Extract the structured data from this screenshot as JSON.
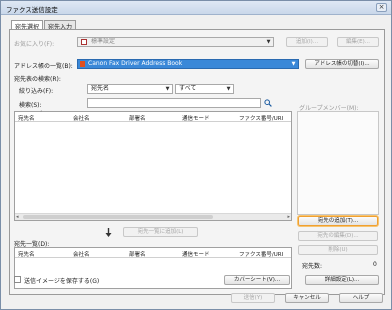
{
  "window": {
    "title": "ファクス送信設定",
    "close": "×"
  },
  "tabs": [
    {
      "label": "宛先選択"
    },
    {
      "label": "宛先入力"
    }
  ],
  "favorites": {
    "label": "お気に入り(F):",
    "value": "標準設定",
    "add": "追加(I)...",
    "edit": "編集(E)..."
  },
  "address_book": {
    "label": "アドレス帳の一覧(B):",
    "value": "Canon Fax Driver Address Book",
    "switch": "アドレス帳の切替(I)..."
  },
  "search": {
    "section_label": "宛先表の検索(R):",
    "filter_label": "絞り込み(F):",
    "filter_field": "宛先名",
    "filter_value": "すべて",
    "search_label": "検索(S):",
    "search_value": ""
  },
  "group_members_label": "グループメンバー(M):",
  "address_columns": [
    "宛先名",
    "会社名",
    "部署名",
    "通信モード",
    "ファクス番号/URI"
  ],
  "add_to_list_label": "宛先一覧に追加(L)",
  "dest_list": {
    "label": "宛先一覧(D):",
    "columns": [
      "宛先名",
      "会社名",
      "部署名",
      "通信モード",
      "ファクス番号/URI"
    ]
  },
  "side_buttons": {
    "add_dest": "宛先の追加(T)...",
    "edit_dest": "宛先の編集(D)...",
    "delete": "削除(U)"
  },
  "dest_count": {
    "label": "宛先数:",
    "value": "0"
  },
  "save_image": "送信イメージを保存する(G)",
  "cover_sheet": "カバーシート(V)...",
  "details": "詳細設定(L)...",
  "footer": {
    "send": "送信(Y)",
    "cancel": "キャンセル",
    "help": "ヘルプ"
  }
}
